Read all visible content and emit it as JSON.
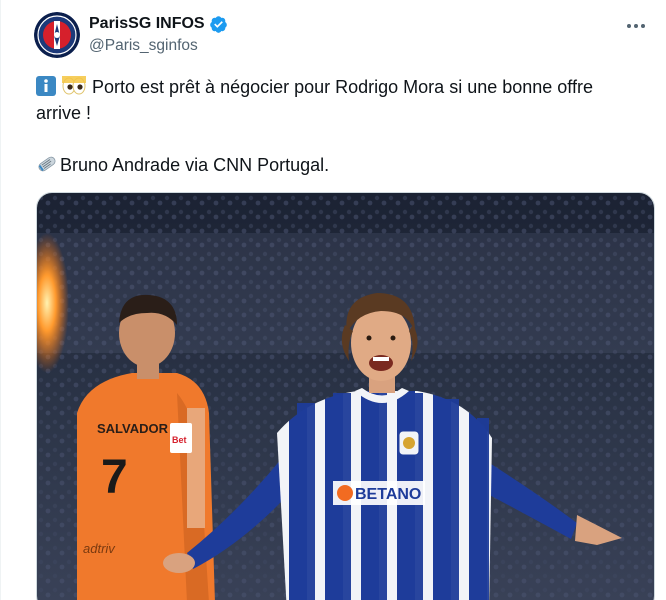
{
  "author": {
    "display_name": "ParisSG INFOS",
    "handle": "@Paris_sginfos",
    "verified": true
  },
  "icons": {
    "avatar": "psg-crest-icon",
    "verified": "verified-badge-icon",
    "more": "more-options-icon",
    "info": "info-emoji-icon",
    "eyes": "eyes-emoji-icon",
    "newspaper": "rolled-newspaper-emoji-icon"
  },
  "tweet": {
    "line1": "Porto est prêt à négocier pour Rodrigo Mora si une bonne offre arrive !",
    "line2": "Bruno Andrade via CNN Portugal."
  },
  "media": {
    "shirt_sponsor": "BETANO",
    "opponent_name": "SALVADOR",
    "opponent_number": "7",
    "opponent_sponsor": "adtriv",
    "opponent_badge": "Bet"
  },
  "colors": {
    "verified": "#1d9bf0",
    "text": "#0f1419",
    "secondary": "#536471",
    "porto_blue": "#1e3c9a",
    "opponent_orange": "#f0792c"
  }
}
